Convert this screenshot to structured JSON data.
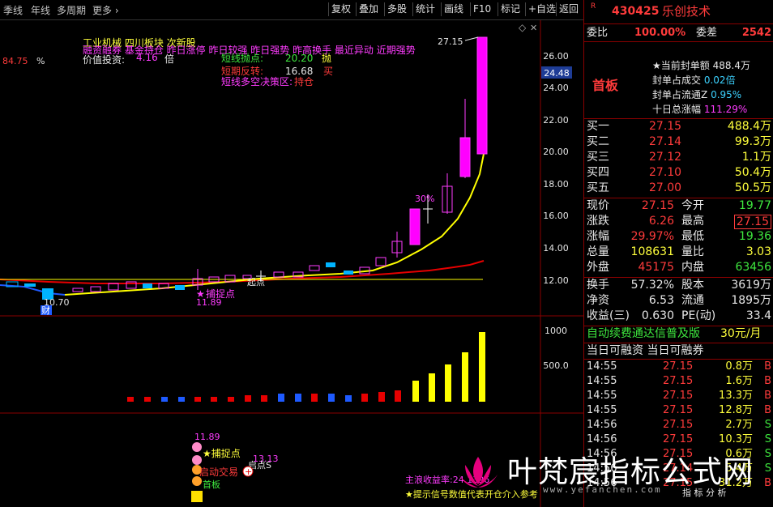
{
  "toolbar": {
    "left_items": [
      "季线",
      "年线",
      "多周期",
      "更多"
    ],
    "buttons": [
      "复权",
      "叠加",
      "多股",
      "统计",
      "画线",
      "F10",
      "标记",
      "+自选",
      "返回"
    ]
  },
  "chart": {
    "indicator_lines": {
      "line1": "工业机械  四川板块  次新股",
      "line2": "融资融券 基金持仓 昨日涨停 昨日较强 昨日强势 昨高换手 最近异动 近期强势",
      "value_label": "价值投资:",
      "value_num": "4.16",
      "value_unit": "倍",
      "left_pct": "84.75",
      "left_pct_unit": "%",
      "short_sell_label": "短线抛点:",
      "short_sell_val": "20.20",
      "short_sell_action": "抛",
      "short_rebound_label": "短期反转:",
      "short_rebound_val": "16.68",
      "short_rebound_action": "买",
      "strategy_label": "短线多空决策区:",
      "strategy_val": "持仓"
    },
    "price_axis": [
      "26.00",
      "24.00",
      "22.00",
      "20.00",
      "18.00",
      "16.00",
      "14.00",
      "12.00"
    ],
    "price_tag": "24.48",
    "high_label": "27.15",
    "low_label": "10.70",
    "capture_label": "捕捉点",
    "capture_val": "11.89",
    "origin_label": "起点",
    "pct_label": "30%",
    "cai_label": "财",
    "vol_axis": [
      "1000",
      "500.0"
    ],
    "bottom": {
      "val_label": "11.89",
      "capture_label": "捕捉点",
      "start_label": "启动交易",
      "board_label": "首板",
      "val2": "13.13",
      "origin2": "启点S",
      "main_yield": "主浪收益率:24.1396",
      "tip": "★提示信号数值代表开仓介入参考"
    }
  },
  "panel": {
    "code_prefix": "R",
    "code": "430425",
    "name": "乐创技术",
    "weibi_label": "委比",
    "weibi_val": "100.00%",
    "weicha_label": "委差",
    "weicha_val": "2542",
    "first_board": "首板",
    "seal_info": [
      {
        "label": "当前封单额",
        "val": "488.4万"
      },
      {
        "label": "封单占成交",
        "val": "0.02倍"
      },
      {
        "label": "封单占流通Z",
        "val": "0.95%"
      },
      {
        "label": "十日总涨幅",
        "val": "111.29%"
      }
    ],
    "bids": [
      {
        "label": "买一",
        "price": "27.15",
        "vol": "488.4万"
      },
      {
        "label": "买二",
        "price": "27.14",
        "vol": "99.3万"
      },
      {
        "label": "买三",
        "price": "27.12",
        "vol": "1.1万"
      },
      {
        "label": "买四",
        "price": "27.10",
        "vol": "50.4万"
      },
      {
        "label": "买五",
        "price": "27.00",
        "vol": "50.5万"
      }
    ],
    "quote": [
      {
        "l1": "现价",
        "v1": "27.15",
        "l2": "今开",
        "v2": "19.77"
      },
      {
        "l1": "涨跌",
        "v1": "6.26",
        "l2": "最高",
        "v2": "27.15"
      },
      {
        "l1": "涨幅",
        "v1": "29.97%",
        "l2": "最低",
        "v2": "19.36"
      },
      {
        "l1": "总量",
        "v1": "108631",
        "l2": "量比",
        "v2": "3.03"
      },
      {
        "l1": "外盘",
        "v1": "45175",
        "l2": "内盘",
        "v2": "63456"
      }
    ],
    "stats": [
      {
        "l1": "换手",
        "v1": "57.32%",
        "l2": "股本",
        "v2": "3619万"
      },
      {
        "l1": "净资",
        "v1": "6.53",
        "l2": "流通",
        "v2": "1895万"
      },
      {
        "l1": "收益(三)",
        "v1": "0.630",
        "l2": "PE(动)",
        "v2": "33.4"
      }
    ],
    "promo": "自动续费通达信普及版",
    "promo_price": "30元/月",
    "margin_line": "当日可融资 当日可融券",
    "trades": [
      {
        "time": "14:55",
        "price": "27.15",
        "vol": "0.8万",
        "side": "B"
      },
      {
        "time": "14:55",
        "price": "27.15",
        "vol": "1.6万",
        "side": "B"
      },
      {
        "time": "14:55",
        "price": "27.15",
        "vol": "13.3万",
        "side": "B"
      },
      {
        "time": "14:55",
        "price": "27.15",
        "vol": "12.8万",
        "side": "B"
      },
      {
        "time": "14:56",
        "price": "27.15",
        "vol": "2.7万",
        "side": "S"
      },
      {
        "time": "14:56",
        "price": "27.15",
        "vol": "10.3万",
        "side": "S"
      },
      {
        "time": "14:56",
        "price": "27.15",
        "vol": "0.6万",
        "side": "S"
      },
      {
        "time": "14:56",
        "price": "27.14",
        "vol": "5.4万",
        "side": "S"
      },
      {
        "time": "14:56",
        "price": "27.15",
        "vol": "31.2万",
        "side": "B"
      }
    ],
    "footer_small": "指 标 分 析"
  },
  "watermark": {
    "text": "叶梵宸指标公式网",
    "url": "www.yefanchen.com"
  },
  "colors": {
    "up": "#ff00ff",
    "down": "#00b4ff",
    "ma_yellow": "#ffff00",
    "ma_red": "#e60000",
    "ma_blue": "#1e5aff"
  }
}
